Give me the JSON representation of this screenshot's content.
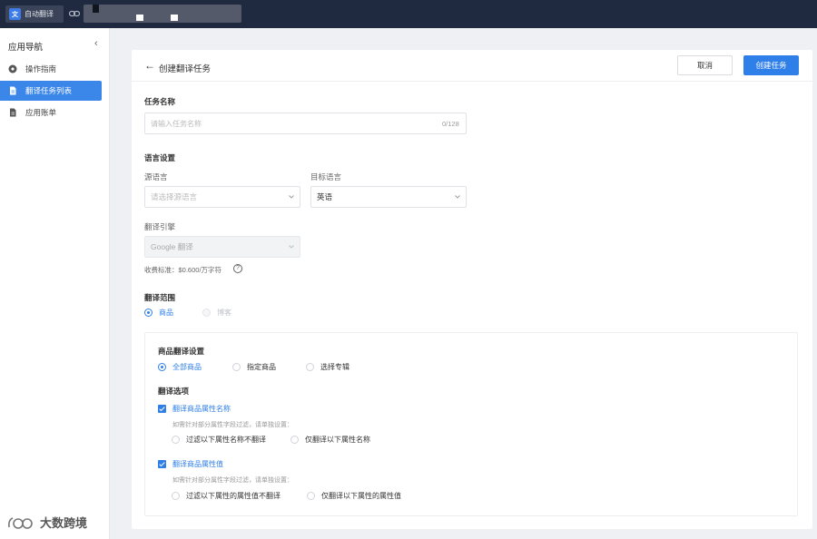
{
  "topbar": {
    "app_name": "自动翻译",
    "colors": {
      "bg": "#1f2940",
      "accent": "#3c7be8"
    }
  },
  "sidebar": {
    "title": "应用导航",
    "collapse_icon": "chevron-left-icon",
    "items": [
      {
        "label": "操作指南",
        "icon": "guide-icon",
        "active": false
      },
      {
        "label": "翻译任务列表",
        "icon": "document-icon",
        "active": true
      },
      {
        "label": "应用账单",
        "icon": "bill-icon",
        "active": false
      }
    ]
  },
  "header": {
    "title": "创建翻译任务",
    "cancel_label": "取消",
    "create_label": "创建任务"
  },
  "form": {
    "task_name": {
      "label": "任务名称",
      "placeholder": "请输入任务名称",
      "value": "",
      "counter": "0/128"
    },
    "language": {
      "section_title": "语言设置",
      "source_label": "源语言",
      "source_placeholder": "请选择源语言",
      "target_label": "目标语言",
      "target_value": "英语",
      "engine_label": "翻译引擎",
      "engine_value": "Google 翻译",
      "fee_text": "收费标准：$0.600/万字符"
    },
    "scope": {
      "section_title": "翻译范围",
      "options": [
        {
          "label": "商品",
          "selected": true,
          "disabled": false
        },
        {
          "label": "博客",
          "selected": false,
          "disabled": true
        }
      ]
    },
    "product_settings": {
      "section_title": "商品翻译设置",
      "options": [
        {
          "label": "全部商品",
          "selected": true
        },
        {
          "label": "指定商品",
          "selected": false
        },
        {
          "label": "选择专辑",
          "selected": false
        }
      ],
      "options_title": "翻译选项",
      "attr_name": {
        "label": "翻译商品属性名称",
        "checked": true,
        "hint": "如需针对部分属性字段过滤，请单独设置：",
        "radios": [
          {
            "label": "过滤以下属性名称不翻译",
            "selected": false
          },
          {
            "label": "仅翻译以下属性名称",
            "selected": false
          }
        ]
      },
      "attr_value": {
        "label": "翻译商品属性值",
        "checked": true,
        "hint": "如需针对部分属性字段过滤，请单独设置：",
        "radios": [
          {
            "label": "过滤以下属性的属性值不翻译",
            "selected": false
          },
          {
            "label": "仅翻译以下属性的属性值",
            "selected": false
          }
        ]
      }
    }
  },
  "watermark": {
    "text": "大数跨境"
  },
  "colors": {
    "primary": "#2f7fe9",
    "page_bg": "#eef0f4"
  }
}
